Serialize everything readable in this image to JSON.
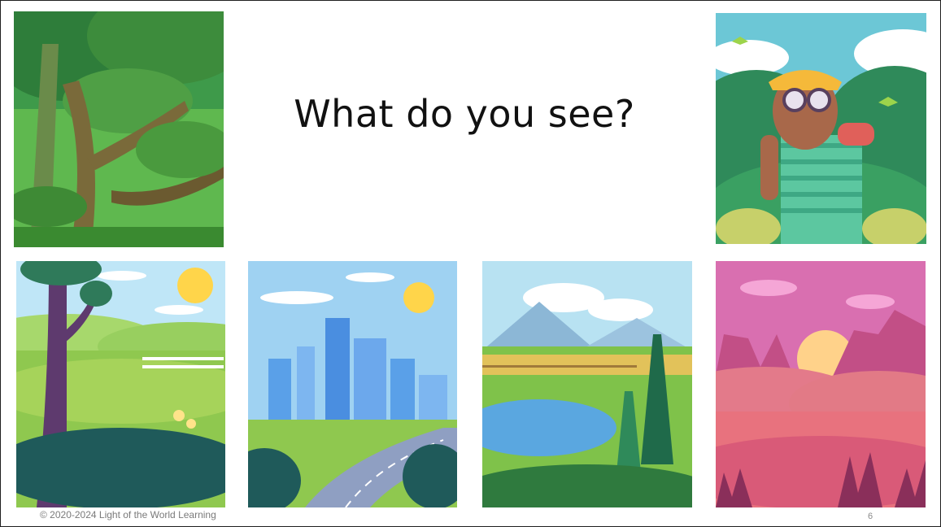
{
  "slide": {
    "title": "What do you see?",
    "footer_copyright": "© 2020-2024 Light of the World Learning",
    "page_number": "6"
  },
  "audio": {
    "icon": "speaker-icon"
  },
  "images": [
    {
      "name": "forest-image",
      "icon": "forest"
    },
    {
      "name": "binoculars-explorer-image",
      "icon": "person-with-binoculars"
    },
    {
      "name": "meadow-tree-image",
      "icon": "meadow"
    },
    {
      "name": "city-road-image",
      "icon": "city"
    },
    {
      "name": "lake-mountains-image",
      "icon": "lake"
    },
    {
      "name": "desert-sunset-image",
      "icon": "desert"
    }
  ]
}
